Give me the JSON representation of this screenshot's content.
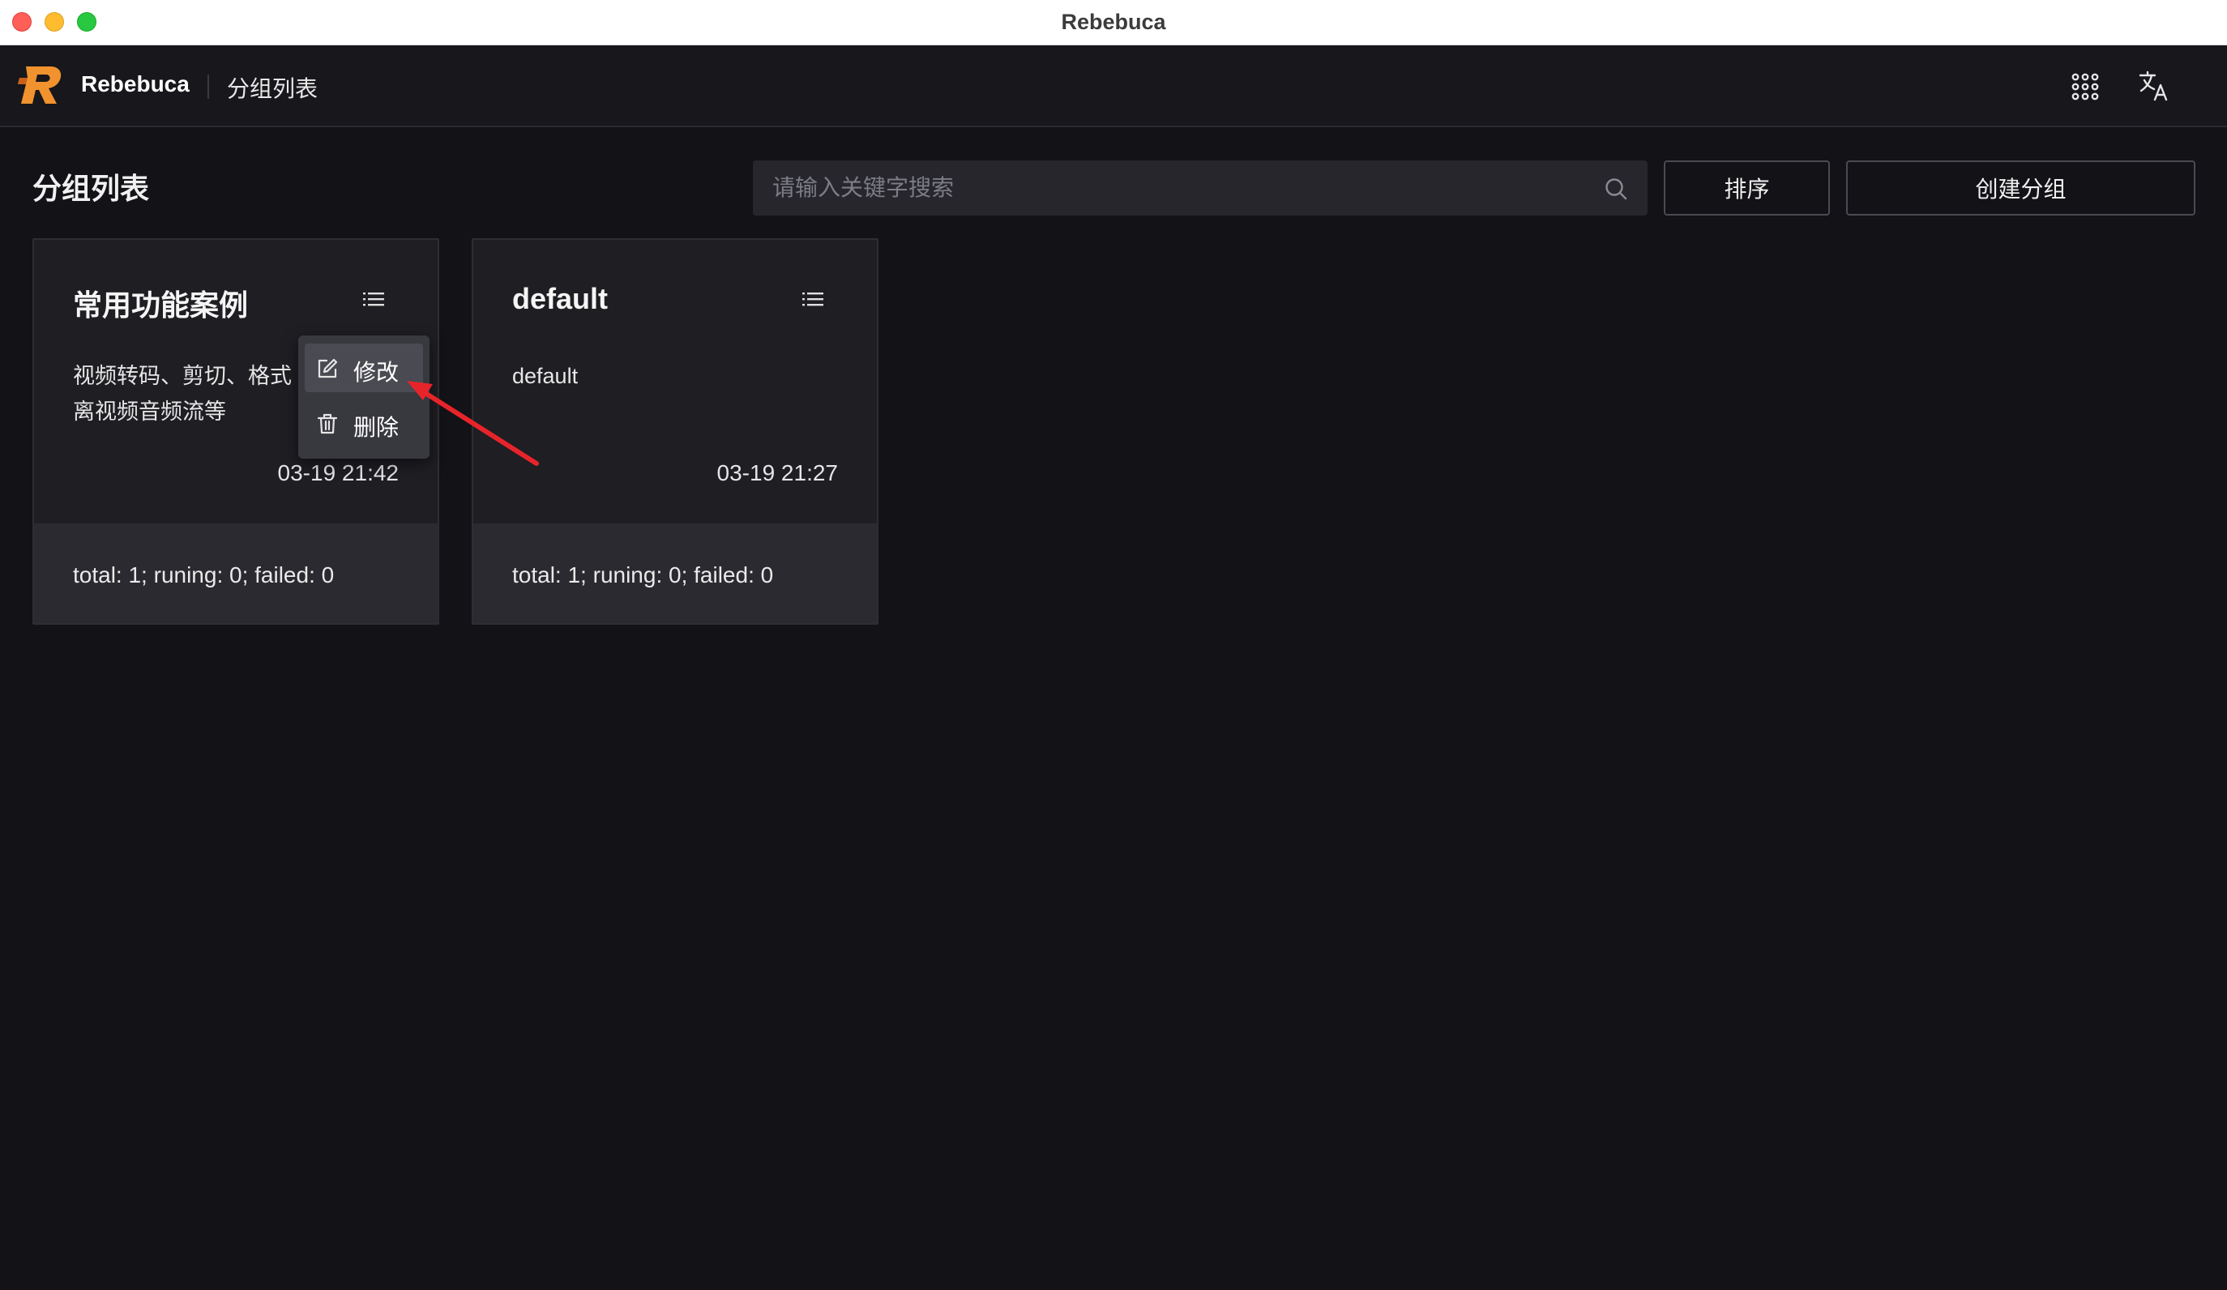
{
  "window": {
    "title": "Rebebuca"
  },
  "header": {
    "brand": "Rebebuca",
    "breadcrumb": "分组列表",
    "apps_icon": "grid-icon",
    "translate_icon": "translate-icon"
  },
  "page": {
    "title": "分组列表"
  },
  "search": {
    "placeholder": "请输入关键字搜索",
    "value": ""
  },
  "toolbar": {
    "sort_label": "排序",
    "create_label": "创建分组"
  },
  "cards": [
    {
      "title": "常用功能案例",
      "description": "视频转码、剪切、格式转换、分离视频音频流等",
      "desc_line1": "视频转码、剪切、格式",
      "desc_line2": "离视频音频流等",
      "time": "03-19 21:42",
      "stats": "total: 1; runing: 0; failed: 0"
    },
    {
      "title": "default",
      "description": "default",
      "time": "03-19 21:27",
      "stats": "total: 1; runing: 0; failed: 0"
    }
  ],
  "context_menu": {
    "edit_label": "修改",
    "delete_label": "删除"
  },
  "colors": {
    "background": "#121217",
    "accent_logo": "#f0922e",
    "arrow": "#e8242b"
  }
}
